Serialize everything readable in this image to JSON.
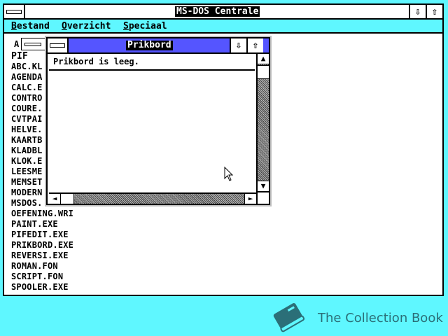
{
  "window": {
    "title": "MS-DOS Centrale",
    "min_glyph": "⇩",
    "max_glyph": "⇧"
  },
  "menu": [
    {
      "accel": "B",
      "rest": "estand"
    },
    {
      "accel": "O",
      "rest": "verzicht"
    },
    {
      "accel": "S",
      "rest": "peciaal"
    }
  ],
  "drive": {
    "label": "A"
  },
  "files": [
    "PIF",
    "ABC.KL",
    "AGENDA",
    "CALC.E",
    "CONTRO",
    "COURE.",
    "CVTPAI",
    "HELVE.",
    "KAARTB",
    "KLADBL",
    "KLOK.E",
    "LEESME",
    "MEMSET",
    "MODERN",
    "MSDOS.",
    "OEFENING.WRI",
    "PAINT.EXE",
    "PIFEDIT.EXE",
    "PRIKBORD.EXE",
    "REVERSI.EXE",
    "ROMAN.FON",
    "SCRIPT.FON",
    "SPOOLER.EXE"
  ],
  "clipboard": {
    "title": "Prikbord",
    "message": "Prikbord is leeg.",
    "min_glyph": "⇩",
    "max_glyph": "⇧",
    "up": "▲",
    "down": "▼",
    "left": "◄",
    "right": "►"
  },
  "brand": {
    "text": "The Collection Book",
    "color": "#2b6f78"
  }
}
